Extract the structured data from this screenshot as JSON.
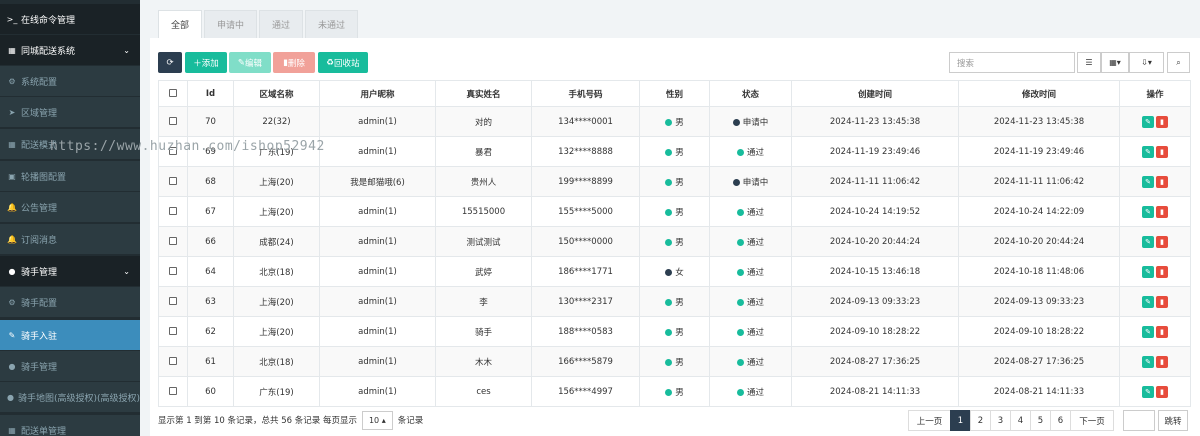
{
  "sidebar": {
    "items": [
      {
        "icon": "terminal-icon",
        "glyph": ">_",
        "label": "在线命令管理",
        "kind": "header"
      },
      {
        "icon": "building-icon",
        "glyph": "▦",
        "label": "同城配送系统",
        "kind": "header",
        "chevron": "⌄"
      },
      {
        "icon": "gears-icon",
        "glyph": "⚙",
        "label": "系统配置",
        "kind": "sub"
      },
      {
        "icon": "location-arrow-icon",
        "glyph": "➤",
        "label": "区域管理",
        "kind": "sub"
      },
      {
        "icon": "grid-icon",
        "glyph": "▦",
        "label": "配送模式",
        "kind": "sub"
      },
      {
        "icon": "image-icon",
        "glyph": "▣",
        "label": "轮播图配置",
        "kind": "sub"
      },
      {
        "icon": "bell-icon",
        "glyph": "🔔",
        "label": "公告管理",
        "kind": "sub"
      },
      {
        "icon": "bell-icon",
        "glyph": "🔔",
        "label": "订阅消息",
        "kind": "sub"
      },
      {
        "icon": "user-circle-icon",
        "glyph": "●",
        "label": "骑手管理",
        "kind": "header",
        "chevron": "⌄"
      },
      {
        "icon": "gear-icon",
        "glyph": "⚙",
        "label": "骑手配置",
        "kind": "sub"
      },
      {
        "icon": "edit-icon",
        "glyph": "✎",
        "label": "骑手入驻",
        "kind": "active"
      },
      {
        "icon": "user-circle-icon",
        "glyph": "●",
        "label": "骑手管理",
        "kind": "sub"
      },
      {
        "icon": "map-marker-icon",
        "glyph": "●",
        "label": "骑手地图(高级授权)(高级授权)",
        "kind": "sub"
      },
      {
        "icon": "grid-icon",
        "glyph": "▦",
        "label": "配送单管理",
        "kind": "sub"
      }
    ]
  },
  "tabs": [
    "全部",
    "申请中",
    "通过",
    "未通过"
  ],
  "toolbar": {
    "add": "添加",
    "edit": "编辑",
    "delete": "删除",
    "recycle": "回收站",
    "search_placeholder": "搜索"
  },
  "table": {
    "headers": [
      "Id",
      "区域名称",
      "用户昵称",
      "真实姓名",
      "手机号码",
      "性别",
      "状态",
      "创建时间",
      "修改时间",
      "操作"
    ],
    "rows": [
      {
        "id": "70",
        "area": "22(32)",
        "nick": "admin(1)",
        "name": "对的",
        "phone": "134****0001",
        "gender": "男",
        "status": "申请中",
        "created": "2024-11-23 13:45:38",
        "updated": "2024-11-23 13:45:38"
      },
      {
        "id": "69",
        "area": "广东(19)",
        "nick": "admin(1)",
        "name": "暴君",
        "phone": "132****8888",
        "gender": "男",
        "status": "通过",
        "created": "2024-11-19 23:49:46",
        "updated": "2024-11-19 23:49:46"
      },
      {
        "id": "68",
        "area": "上海(20)",
        "nick": "我是邮猫哦(6)",
        "name": "贵州人",
        "phone": "199****8899",
        "gender": "男",
        "status": "申请中",
        "created": "2024-11-11 11:06:42",
        "updated": "2024-11-11 11:06:42"
      },
      {
        "id": "67",
        "area": "上海(20)",
        "nick": "admin(1)",
        "name": "15515000",
        "phone": "155****5000",
        "gender": "男",
        "status": "通过",
        "created": "2024-10-24 14:19:52",
        "updated": "2024-10-24 14:22:09"
      },
      {
        "id": "66",
        "area": "成都(24)",
        "nick": "admin(1)",
        "name": "测试测试",
        "phone": "150****0000",
        "gender": "男",
        "status": "通过",
        "created": "2024-10-20 20:44:24",
        "updated": "2024-10-20 20:44:24"
      },
      {
        "id": "64",
        "area": "北京(18)",
        "nick": "admin(1)",
        "name": "武婷",
        "phone": "186****1771",
        "gender": "女",
        "status": "通过",
        "created": "2024-10-15 13:46:18",
        "updated": "2024-10-18 11:48:06"
      },
      {
        "id": "63",
        "area": "上海(20)",
        "nick": "admin(1)",
        "name": "李",
        "phone": "130****2317",
        "gender": "男",
        "status": "通过",
        "created": "2024-09-13 09:33:23",
        "updated": "2024-09-13 09:33:23"
      },
      {
        "id": "62",
        "area": "上海(20)",
        "nick": "admin(1)",
        "name": "骑手",
        "phone": "188****0583",
        "gender": "男",
        "status": "通过",
        "created": "2024-09-10 18:28:22",
        "updated": "2024-09-10 18:28:22"
      },
      {
        "id": "61",
        "area": "北京(18)",
        "nick": "admin(1)",
        "name": "木木",
        "phone": "166****5879",
        "gender": "男",
        "status": "通过",
        "created": "2024-08-27 17:36:25",
        "updated": "2024-08-27 17:36:25"
      },
      {
        "id": "60",
        "area": "广东(19)",
        "nick": "admin(1)",
        "name": "ces",
        "phone": "156****4997",
        "gender": "男",
        "status": "通过",
        "created": "2024-08-21 14:11:33",
        "updated": "2024-08-21 14:11:33"
      }
    ]
  },
  "footer": {
    "summary_before": "显示第 1 到第 10 条记录，总共 56 条记录 每页显示",
    "page_size": "10",
    "summary_after": "条记录",
    "prev": "上一页",
    "pages": [
      "1",
      "2",
      "3",
      "4",
      "5",
      "6"
    ],
    "next": "下一页",
    "jump": "跳转"
  },
  "watermark": "https://www.huzhan.com/ishop52942",
  "colors": {
    "sidebar_bg": "#222d32",
    "active": "#3c8dbc",
    "success": "#18bc9c",
    "danger": "#e74c3c",
    "dark": "#2c3e50"
  }
}
